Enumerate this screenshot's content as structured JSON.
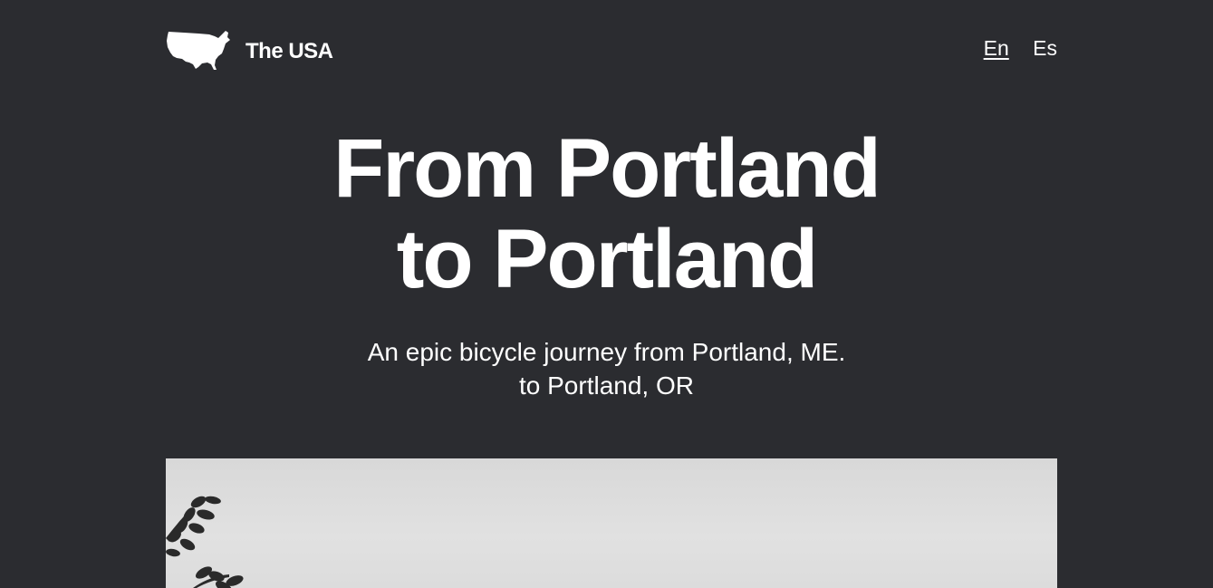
{
  "header": {
    "brand_name": "The USA",
    "brand_icon": "usa-map-icon",
    "languages": [
      {
        "label": "En",
        "active": true
      },
      {
        "label": "Es",
        "active": false
      }
    ]
  },
  "hero": {
    "title_line1": "From Portland",
    "title_line2": "to Portland",
    "subtitle_line1": "An epic bicycle journey from Portland, ME.",
    "subtitle_line2": "to Portland, OR"
  },
  "colors": {
    "background": "#2b2c30",
    "text": "#ffffff",
    "photo": "#dcdcdc"
  }
}
